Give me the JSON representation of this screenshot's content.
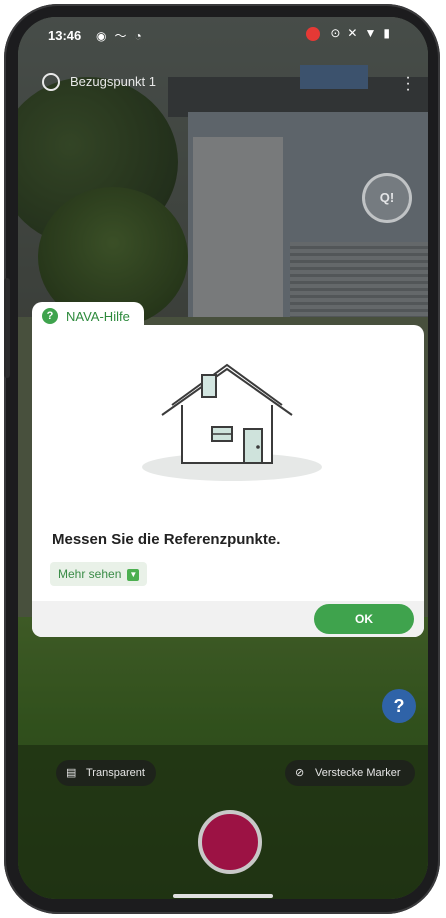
{
  "status_bar": {
    "time": "13:46",
    "left_icons": [
      "location-icon",
      "wave-icon",
      "wifi-icon"
    ],
    "right_icons": [
      "record-icon",
      "location-pin-icon",
      "mute-icon",
      "wifi-icon",
      "battery-icon"
    ]
  },
  "top_bar": {
    "reference_label": "Bezugspunkt 1"
  },
  "qr_button": {
    "label": "Q!"
  },
  "dialog": {
    "tab_title": "NAVA-Hilfe",
    "message": "Messen Sie die Referenzpunkte.",
    "more_label": "Mehr sehen",
    "ok_label": "OK",
    "accent_color": "#3fa34d"
  },
  "help_button": {
    "label": "?"
  },
  "bottom": {
    "transparent_label": "Transparent",
    "hide_marker_label": "Verstecke Marker",
    "record_color": "#9c1244"
  }
}
